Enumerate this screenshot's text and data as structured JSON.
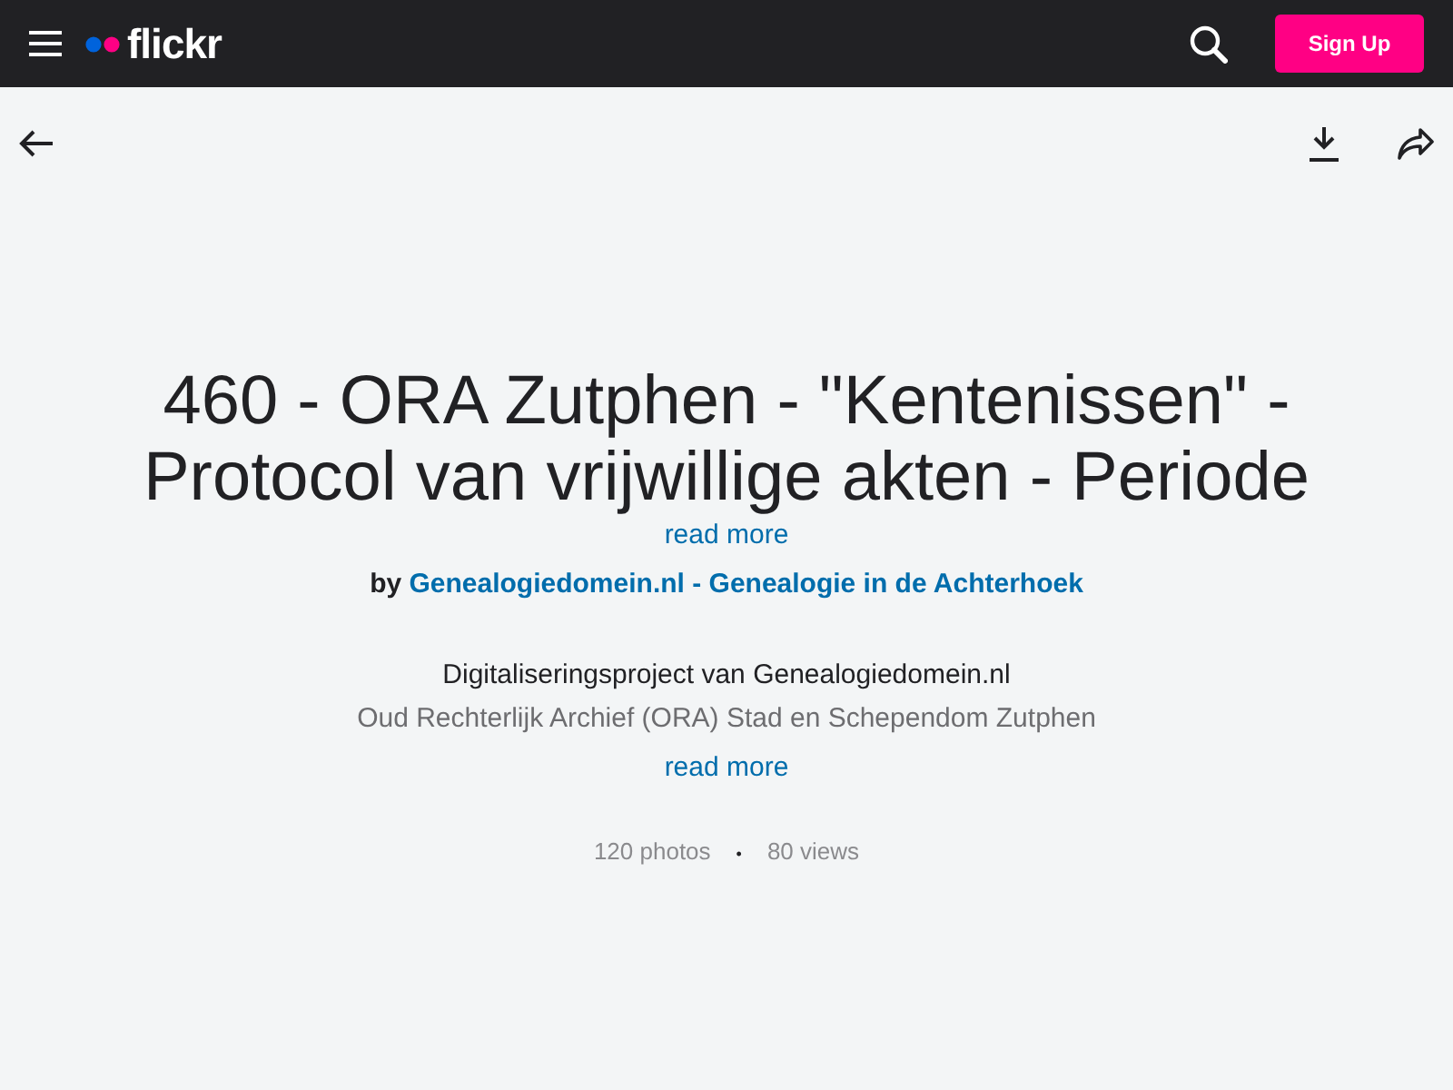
{
  "header": {
    "logo": "flickr",
    "signup": "Sign Up"
  },
  "album": {
    "title_lines": [
      "460 - ORA Zutphen - \"Kentenissen\" -",
      "Protocol van vrijwillige akten - Periode"
    ],
    "title_more": "read more",
    "by": "by",
    "owner": "Genealogiedomein.nl - Genealogie in de Achterhoek",
    "description": [
      "Digitaliseringsproject van Genealogiedomein.nl",
      "Oud Rechterlijk Archief (ORA) Stad en Schependom Zutphen"
    ],
    "description_more": "read more",
    "photos": "120 photos",
    "separator": "•",
    "views": "80 views"
  }
}
